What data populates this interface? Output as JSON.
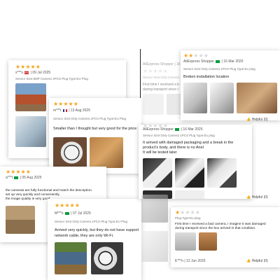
{
  "reviews": {
    "r1": {
      "stars": 5,
      "author": "s***s",
      "date": "09 Jul 2025",
      "variant": "Sensor Size:8MP Camera 4PCS Plug Type:EU Plug"
    },
    "r2": {
      "stars": 5,
      "author": "m***t",
      "date": "13 Aug 2025",
      "variant": "Sensor Size:Only Camera 1PCS Plug Type:EU Plug",
      "text": "Smaller than I thought but very good for the price"
    },
    "r3": {
      "stars": 5,
      "author": "a***t",
      "date": "05 Aug 2025",
      "text_lines": [
        "the cameras are fully functional and match the description.",
        "set up very quickly and conveniently.",
        "the image quality is very good"
      ]
    },
    "r4": {
      "stars": 5,
      "author": "M***s",
      "date": "07 Jul 2025",
      "variant": "Sensor Size:Only Camera 1PCS Plug Type:EU Plug",
      "text_lines": [
        "Arrived very quickly, but they do not have support",
        "network cable, they are only Wi-Fi."
      ]
    },
    "r5": {
      "stars": 2,
      "author": "AliExpress Shopper",
      "date": "16 Mar 2025",
      "variant": "Sensor Size:Only Camera 1PCS Plug Type:Eu plug",
      "text": "Broken installation location"
    },
    "r5b": {
      "author": "AliExpress Shopper",
      "date": "16 Mar 2025",
      "variant": "Sensor Size:Only Camera 1PCS Plug Type:Eu plug",
      "text_lines": [
        "First time I received a b",
        "during transport since t"
      ]
    },
    "r6": {
      "author": "AliExpress Shopper",
      "date": "16 Mar 2025",
      "variant": "Sensor Size:Only Camera 1PCS Plug Type:Eu plug",
      "text_lines": [
        "It arrived with damaged packaging and a break in the",
        "product's body, and there is no Anel",
        "It will be tested later"
      ],
      "helpful": "Helpful (0)"
    },
    "r7": {
      "variant": "Plug Type:Eu plug",
      "text_lines": [
        "First time I received a bad camera, I imagine it was damaged",
        "during transport since the box arrived in that condition."
      ],
      "author": "E***n",
      "date": "12 Jun 2025",
      "helpful": "Helpful (0)"
    }
  },
  "helpful_right_top": "Helpful (0)",
  "helpful_right_mid": "Helpful (0)",
  "colors": {
    "star": "#f5a623",
    "star_off": "#d8d8d8"
  }
}
